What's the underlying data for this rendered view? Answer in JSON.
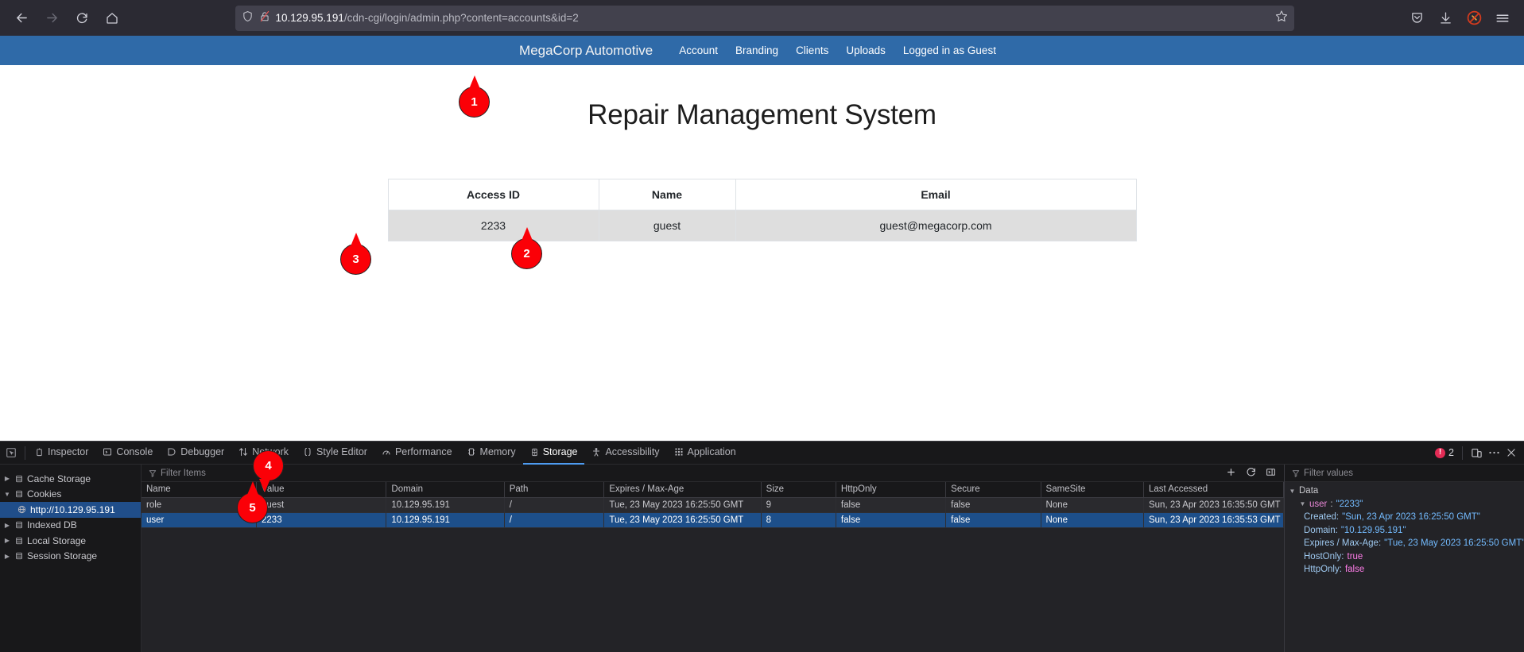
{
  "browser": {
    "url_host": "10.129.95.191",
    "url_path": "/cdn-cgi/login/admin.php?content=accounts&id=2",
    "icons": {
      "back": "back-arrow-icon",
      "forward": "forward-arrow-icon",
      "reload": "reload-icon",
      "home": "home-icon",
      "shield": "shield-icon",
      "lock_broken": "broken-lock-icon",
      "bookmark": "star-icon",
      "pocket": "pocket-icon",
      "downloads": "downloads-icon",
      "extension": "blocked-extension-icon",
      "menu": "hamburger-menu-icon"
    }
  },
  "site_nav": {
    "brand": "MegaCorp Automotive",
    "links": [
      {
        "label": "Account"
      },
      {
        "label": "Branding"
      },
      {
        "label": "Clients"
      },
      {
        "label": "Uploads"
      },
      {
        "label": "Logged in as Guest"
      }
    ]
  },
  "page": {
    "title": "Repair Management System",
    "table": {
      "headers": [
        "Access ID",
        "Name",
        "Email"
      ],
      "rows": [
        {
          "access_id": "2233",
          "name": "guest",
          "email": "guest@megacorp.com"
        }
      ]
    }
  },
  "markers": [
    {
      "label": "1"
    },
    {
      "label": "2"
    },
    {
      "label": "3"
    },
    {
      "label": "4"
    },
    {
      "label": "5"
    }
  ],
  "devtools": {
    "tabs": [
      {
        "label": "Inspector",
        "active": false
      },
      {
        "label": "Console",
        "active": false
      },
      {
        "label": "Debugger",
        "active": false
      },
      {
        "label": "Network",
        "active": false
      },
      {
        "label": "Style Editor",
        "active": false
      },
      {
        "label": "Performance",
        "active": false
      },
      {
        "label": "Memory",
        "active": false
      },
      {
        "label": "Storage",
        "active": true
      },
      {
        "label": "Accessibility",
        "active": false
      },
      {
        "label": "Application",
        "active": false
      }
    ],
    "error_count": "2",
    "storage_tree": [
      {
        "label": "Cache Storage",
        "expanded": false,
        "selected": false,
        "child": false
      },
      {
        "label": "Cookies",
        "expanded": true,
        "selected": false,
        "child": false
      },
      {
        "label": "http://10.129.95.191",
        "expanded": null,
        "selected": true,
        "child": true
      },
      {
        "label": "Indexed DB",
        "expanded": false,
        "selected": false,
        "child": false
      },
      {
        "label": "Local Storage",
        "expanded": false,
        "selected": false,
        "child": false
      },
      {
        "label": "Session Storage",
        "expanded": false,
        "selected": false,
        "child": false
      }
    ],
    "filter_items_placeholder": "Filter Items",
    "filter_values_placeholder": "Filter values",
    "cookie_headers": [
      "Name",
      "Value",
      "Domain",
      "Path",
      "Expires / Max-Age",
      "Size",
      "HttpOnly",
      "Secure",
      "SameSite",
      "Last Accessed"
    ],
    "cookie_rows": [
      {
        "name": "role",
        "value": "guest",
        "domain": "10.129.95.191",
        "path": "/",
        "expires": "Tue, 23 May 2023 16:25:50 GMT",
        "size": "9",
        "httponly": "false",
        "secure": "false",
        "samesite": "None",
        "last_accessed": "Sun, 23 Apr 2023 16:35:50 GMT",
        "selected": false
      },
      {
        "name": "user",
        "value": "2233",
        "domain": "10.129.95.191",
        "path": "/",
        "expires": "Tue, 23 May 2023 16:25:50 GMT",
        "size": "8",
        "httponly": "false",
        "secure": "false",
        "samesite": "None",
        "last_accessed": "Sun, 23 Apr 2023 16:35:53 GMT",
        "selected": true
      }
    ],
    "data_panel": {
      "root_label": "Data",
      "cookie_key": "user",
      "cookie_value": "\"2233\"",
      "props": [
        {
          "key": "Created:",
          "value": "\"Sun, 23 Apr 2023 16:25:50 GMT\"",
          "type": "str"
        },
        {
          "key": "Domain:",
          "value": "\"10.129.95.191\"",
          "type": "str"
        },
        {
          "key": "Expires / Max-Age:",
          "value": "\"Tue, 23 May 2023 16:25:50 GMT\"",
          "type": "str"
        },
        {
          "key": "HostOnly:",
          "value": "true",
          "type": "bool"
        },
        {
          "key": "HttpOnly:",
          "value": "false",
          "type": "bool"
        }
      ]
    },
    "toolbar_icons": {
      "picker": "element-picker-icon",
      "add": "plus-icon",
      "refresh": "refresh-icon",
      "sidebar": "toggle-sidebar-icon",
      "responsive": "responsive-design-mode-icon",
      "meatball": "more-options-icon",
      "close": "close-icon"
    }
  },
  "colors": {
    "brand_blue": "#2f6aa8",
    "marker_red": "#fb0007",
    "devtools_accent": "#4e9bf0",
    "selection_blue": "#1d4f8a"
  }
}
